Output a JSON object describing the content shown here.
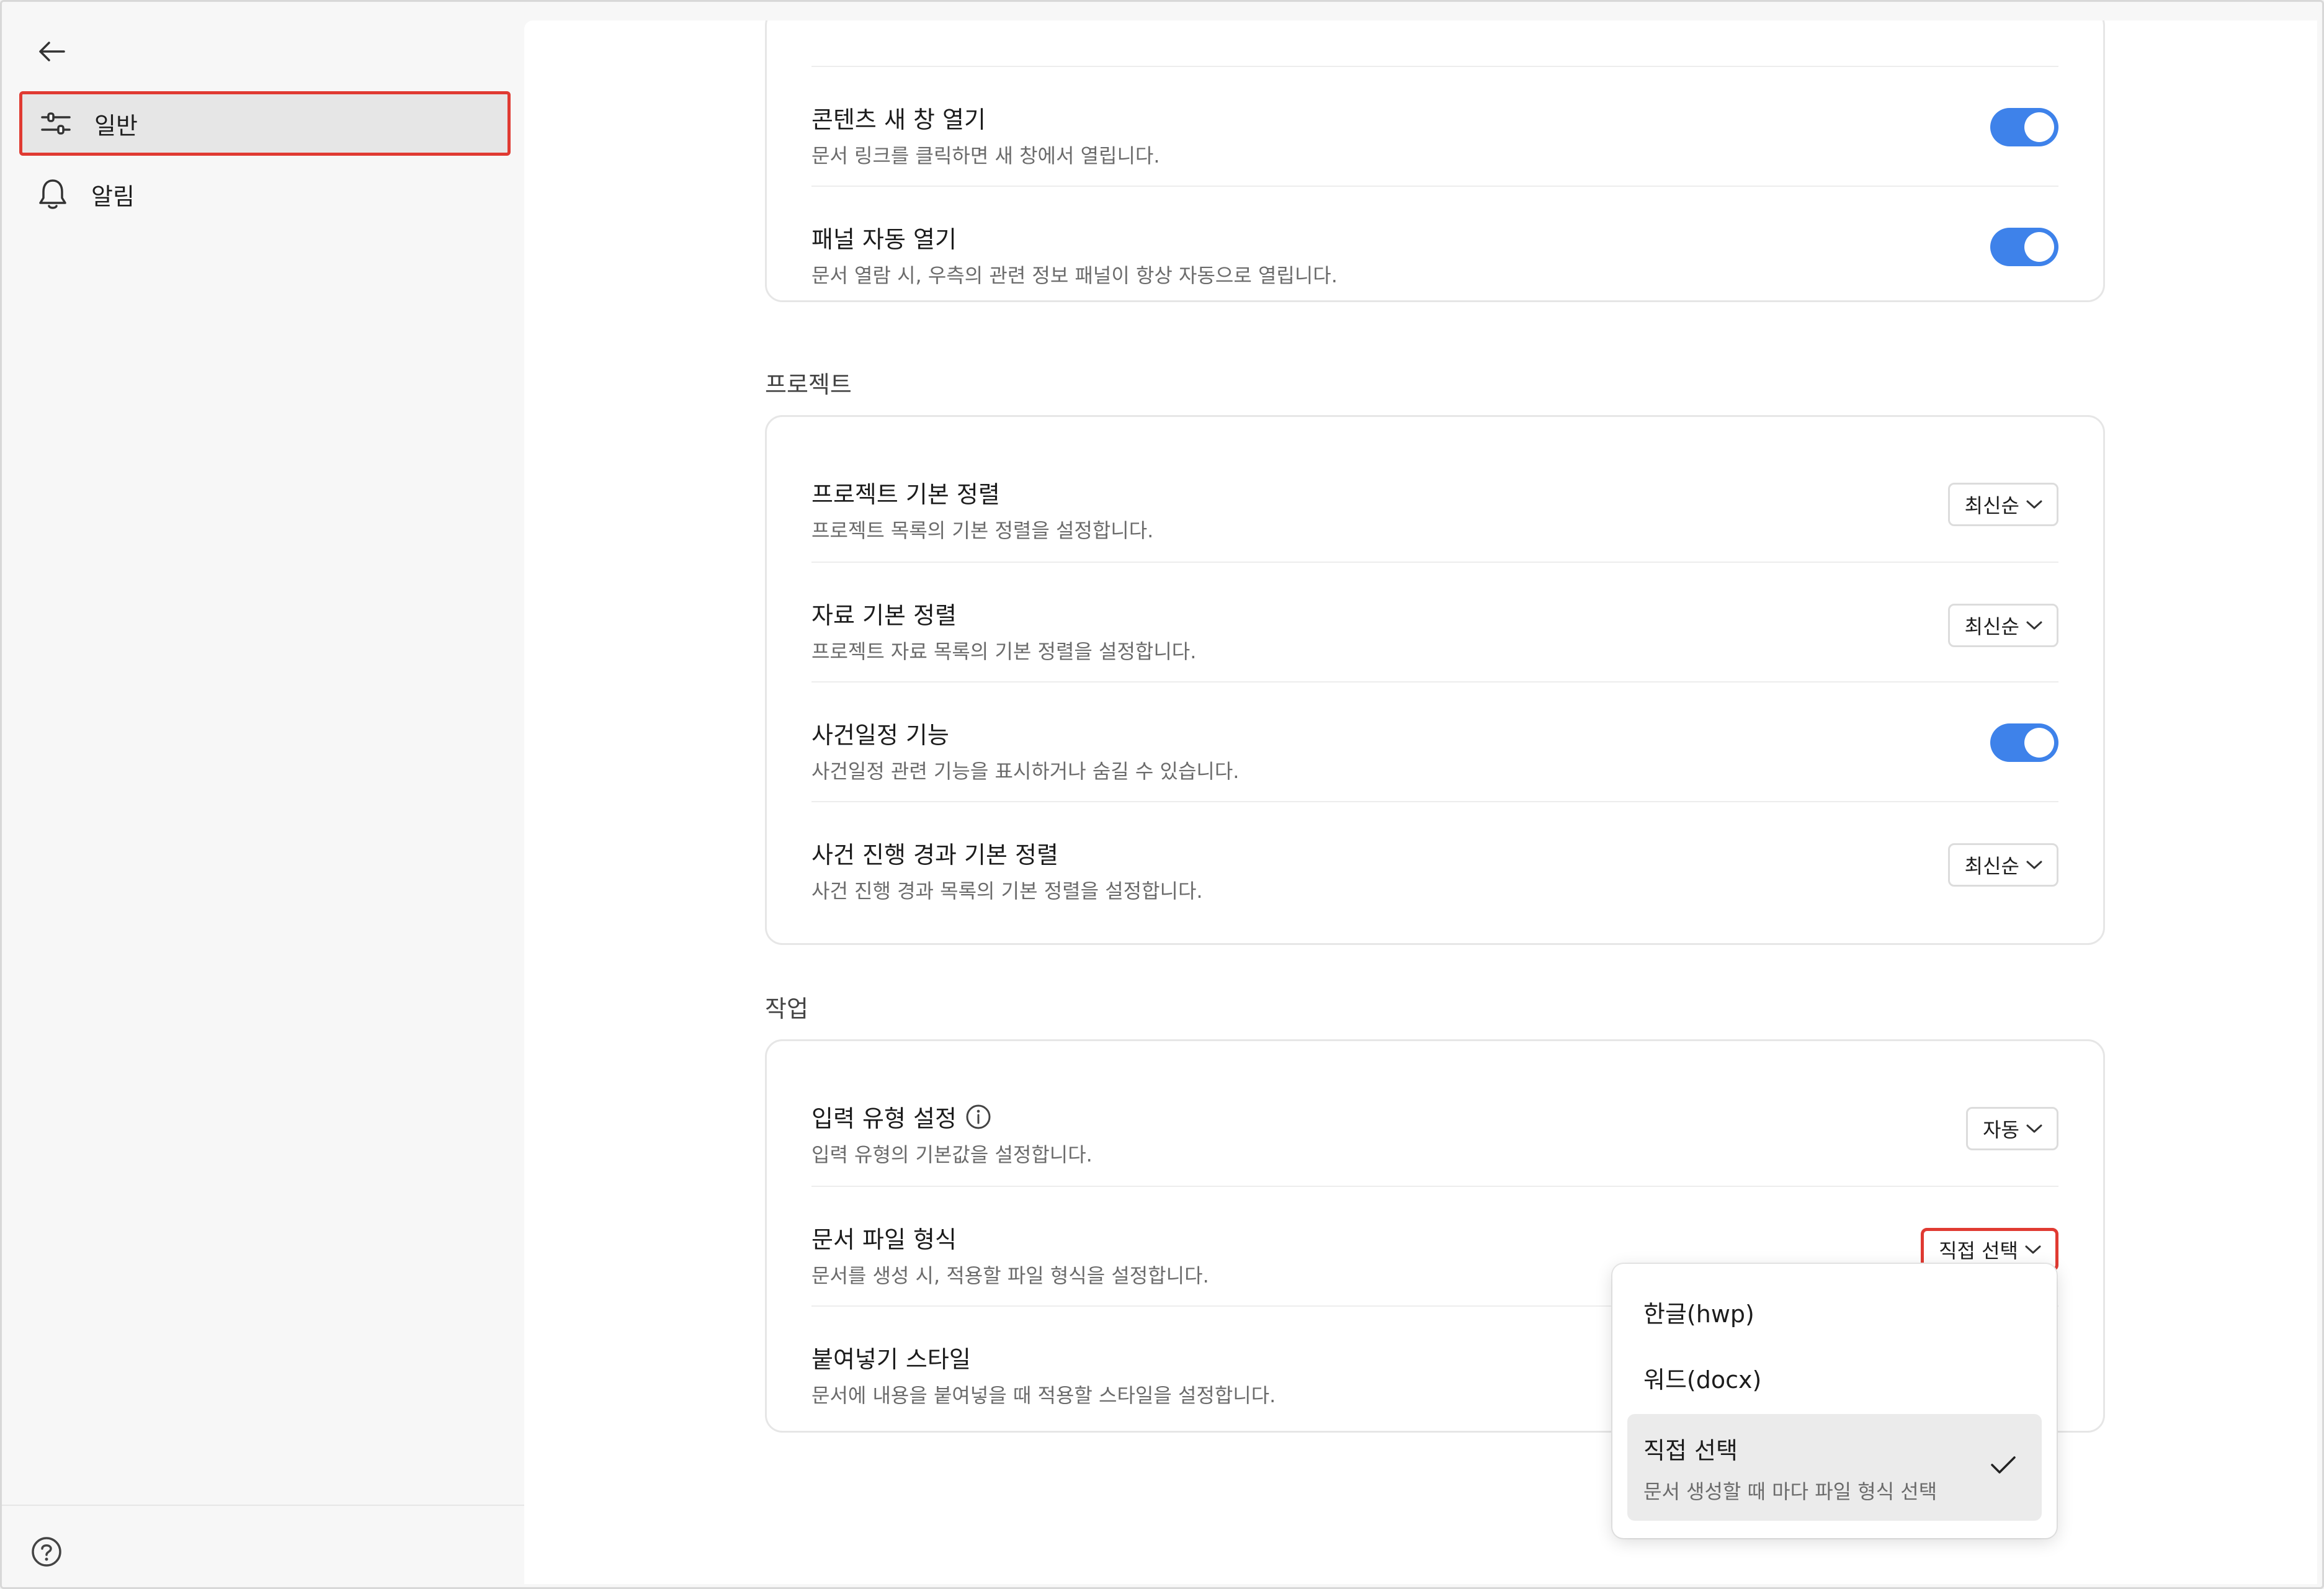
{
  "sidebar": {
    "back_icon": "arrow-left-icon",
    "items": [
      {
        "label": "일반",
        "icon": "sliders-icon",
        "active": true
      },
      {
        "label": "알림",
        "icon": "bell-icon",
        "active": false
      }
    ],
    "help_icon": "help-circle-icon"
  },
  "general_card": {
    "rows": [
      {
        "title": "콘텐츠 새 창 열기",
        "desc": "문서 링크를 클릭하면 새 창에서 열립니다.",
        "control": "toggle",
        "on": true
      },
      {
        "title": "패널 자동 열기",
        "desc": "문서 열람 시, 우측의 관련 정보 패널이 항상 자동으로 열립니다.",
        "control": "toggle",
        "on": true
      }
    ]
  },
  "project_section": {
    "label": "프로젝트",
    "rows": [
      {
        "title": "프로젝트 기본 정렬",
        "desc": "프로젝트 목록의 기본 정렬을 설정합니다.",
        "control": "select",
        "value": "최신순"
      },
      {
        "title": "자료 기본 정렬",
        "desc": "프로젝트 자료 목록의 기본 정렬을 설정합니다.",
        "control": "select",
        "value": "최신순"
      },
      {
        "title": "사건일정 기능",
        "desc": "사건일정 관련 기능을 표시하거나 숨길 수 있습니다.",
        "control": "toggle",
        "on": true
      },
      {
        "title": "사건 진행 경과 기본 정렬",
        "desc": "사건 진행 경과 목록의 기본 정렬을 설정합니다.",
        "control": "select",
        "value": "최신순"
      }
    ]
  },
  "work_section": {
    "label": "작업",
    "rows": [
      {
        "title": "입력 유형 설정",
        "desc": "입력 유형의 기본값을 설정합니다.",
        "control": "select",
        "value": "자동",
        "info_icon": "info-circle-icon"
      },
      {
        "title": "문서 파일 형식",
        "desc": "문서를 생성 시, 적용할 파일 형식을 설정합니다.",
        "control": "select",
        "value": "직접 선택"
      },
      {
        "title": "붙여넣기 스타일",
        "desc": "문서에 내용을 붙여넣을 때 적용할 스타일을 설정합니다."
      }
    ]
  },
  "dropdown": {
    "options": [
      {
        "label": "한글(hwp)"
      },
      {
        "label": "워드(docx)"
      },
      {
        "label": "직접 선택",
        "desc": "문서 생성할 때 마다 파일 형식 선택",
        "selected": true,
        "icon": "check-icon"
      }
    ]
  },
  "colors": {
    "accent": "#3e82ea",
    "highlight": "#e03a32"
  }
}
